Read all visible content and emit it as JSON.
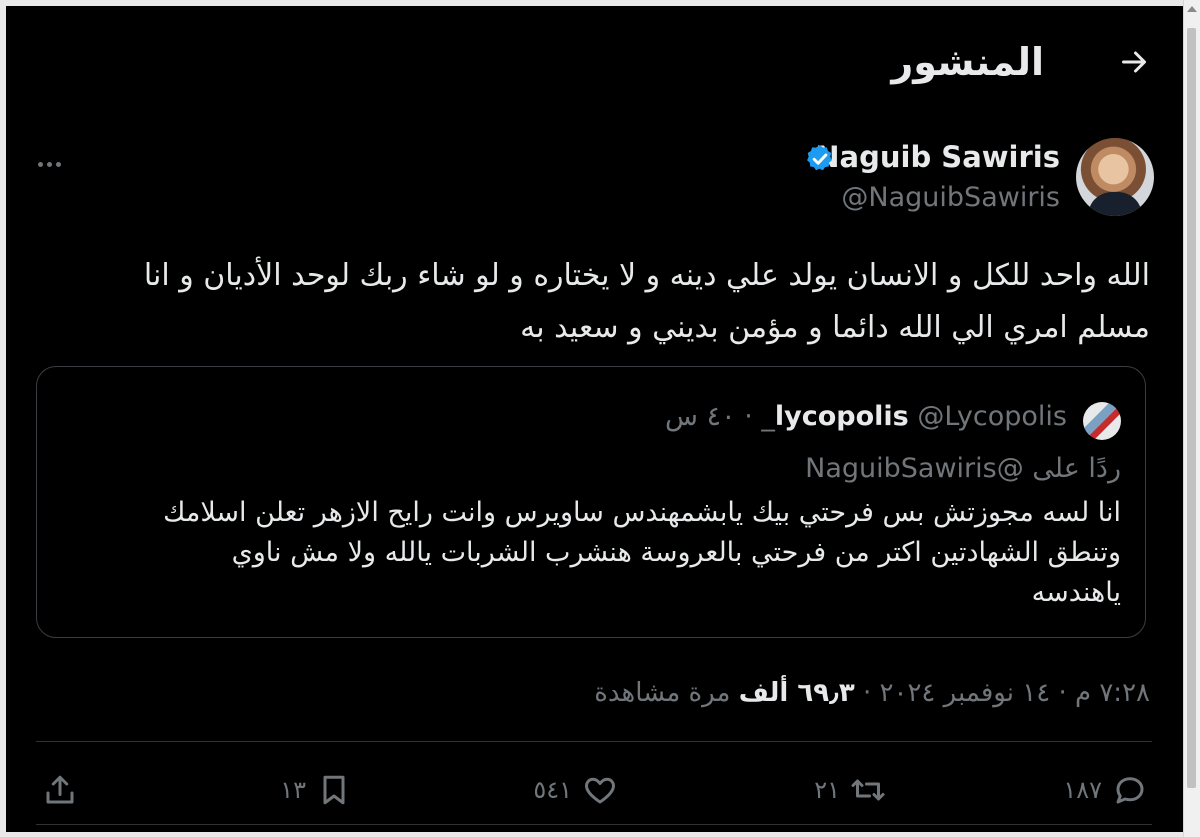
{
  "header": {
    "title": "المنشور"
  },
  "author": {
    "display_name": "Naguib Sawiris",
    "handle": "@NaguibSawiris"
  },
  "tweet": {
    "text": "الله واحد للكل و الانسان يولد علي دينه و لا يختاره و  لو شاء ربك لوحد الأديان و انا\nمسلم امري الي الله دائما و مؤمن بديني و سعيد به"
  },
  "quote": {
    "name": "lycopolis",
    "handle": "@Lycopolis_",
    "separator": "·",
    "time": "٤٠ س",
    "replying_to": "ردًا على @NaguibSawiris",
    "text": "انا لسه مجوزتش بس فرحتي بيك يابشمهندس ساويرس وانت رايح الازهر تعلن اسلامك\nوتنطق الشهادتين اكتر من فرحتي بالعروسة هنشرب الشربات يالله ولا مش ناوي\nياهندسه"
  },
  "meta": {
    "time": "٧:٢٨ م",
    "date": "١٤ نوفمبر ٢٠٢٤",
    "views_count": "٦٩٫٣ ألف",
    "views_label": "مرة مشاهدة",
    "separator": "·"
  },
  "actions": {
    "replies": "١٨٧",
    "reposts": "٢١",
    "likes": "٥٤١",
    "bookmarks": "١٣"
  },
  "icons": [
    "back-arrow-icon",
    "verified-badge-icon",
    "more-icon",
    "reply-icon",
    "repost-icon",
    "like-icon",
    "bookmark-icon",
    "share-icon"
  ],
  "colors": {
    "background": "#000000",
    "text": "#e7e9ea",
    "muted": "#71767b",
    "verified": "#1d9bf0",
    "border": "#2f3336"
  }
}
